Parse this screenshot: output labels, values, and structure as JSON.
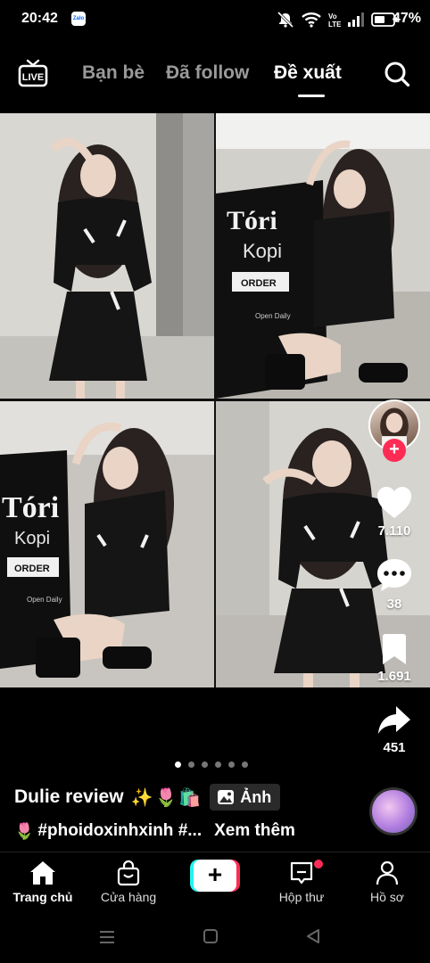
{
  "status_bar": {
    "time": "20:42",
    "zalo_label": "Zalo",
    "battery": "47%"
  },
  "top_nav": {
    "live_label": "LIVE",
    "tabs": [
      {
        "label": "Bạn bè",
        "active": false
      },
      {
        "label": "Đã follow",
        "active": false
      },
      {
        "label": "Đề xuất",
        "active": true
      }
    ]
  },
  "post": {
    "photos": [
      {
        "sign_title": "",
        "sign_sub": ""
      },
      {
        "sign_title": "Tóri",
        "sign_sub": "Kopi",
        "sign_btn": "ORDER",
        "sign_hours": "Open Daily"
      },
      {
        "sign_title": "Tóri",
        "sign_sub": "Kopi",
        "sign_btn": "ORDER",
        "sign_hours": "Open Daily"
      },
      {
        "sign_title": "",
        "sign_sub": ""
      }
    ],
    "likes": "7.110",
    "comments": "38",
    "saves": "1.691",
    "shares": "451",
    "page_count": 6,
    "active_page": 1,
    "author": "Dulie review",
    "author_emojis": "✨🌷🛍️",
    "chip_label": "Ảnh",
    "caption_emoji": "🌷",
    "caption": "#phoidoxinhxinh #...",
    "see_more": "Xem thêm"
  },
  "bottom_nav": {
    "home": "Trang chủ",
    "shop": "Cửa hàng",
    "create": "+",
    "inbox": "Hộp thư",
    "profile": "Hồ sơ"
  },
  "colors": {
    "accent": "#fe2c55",
    "cyan": "#25f4ee",
    "inactive_tab": "#9a9a9a"
  },
  "icons": [
    "live-icon",
    "search-icon",
    "heart-icon",
    "comment-icon",
    "bookmark-icon",
    "share-icon",
    "image-icon",
    "home-icon",
    "shop-icon",
    "inbox-icon",
    "profile-icon"
  ]
}
